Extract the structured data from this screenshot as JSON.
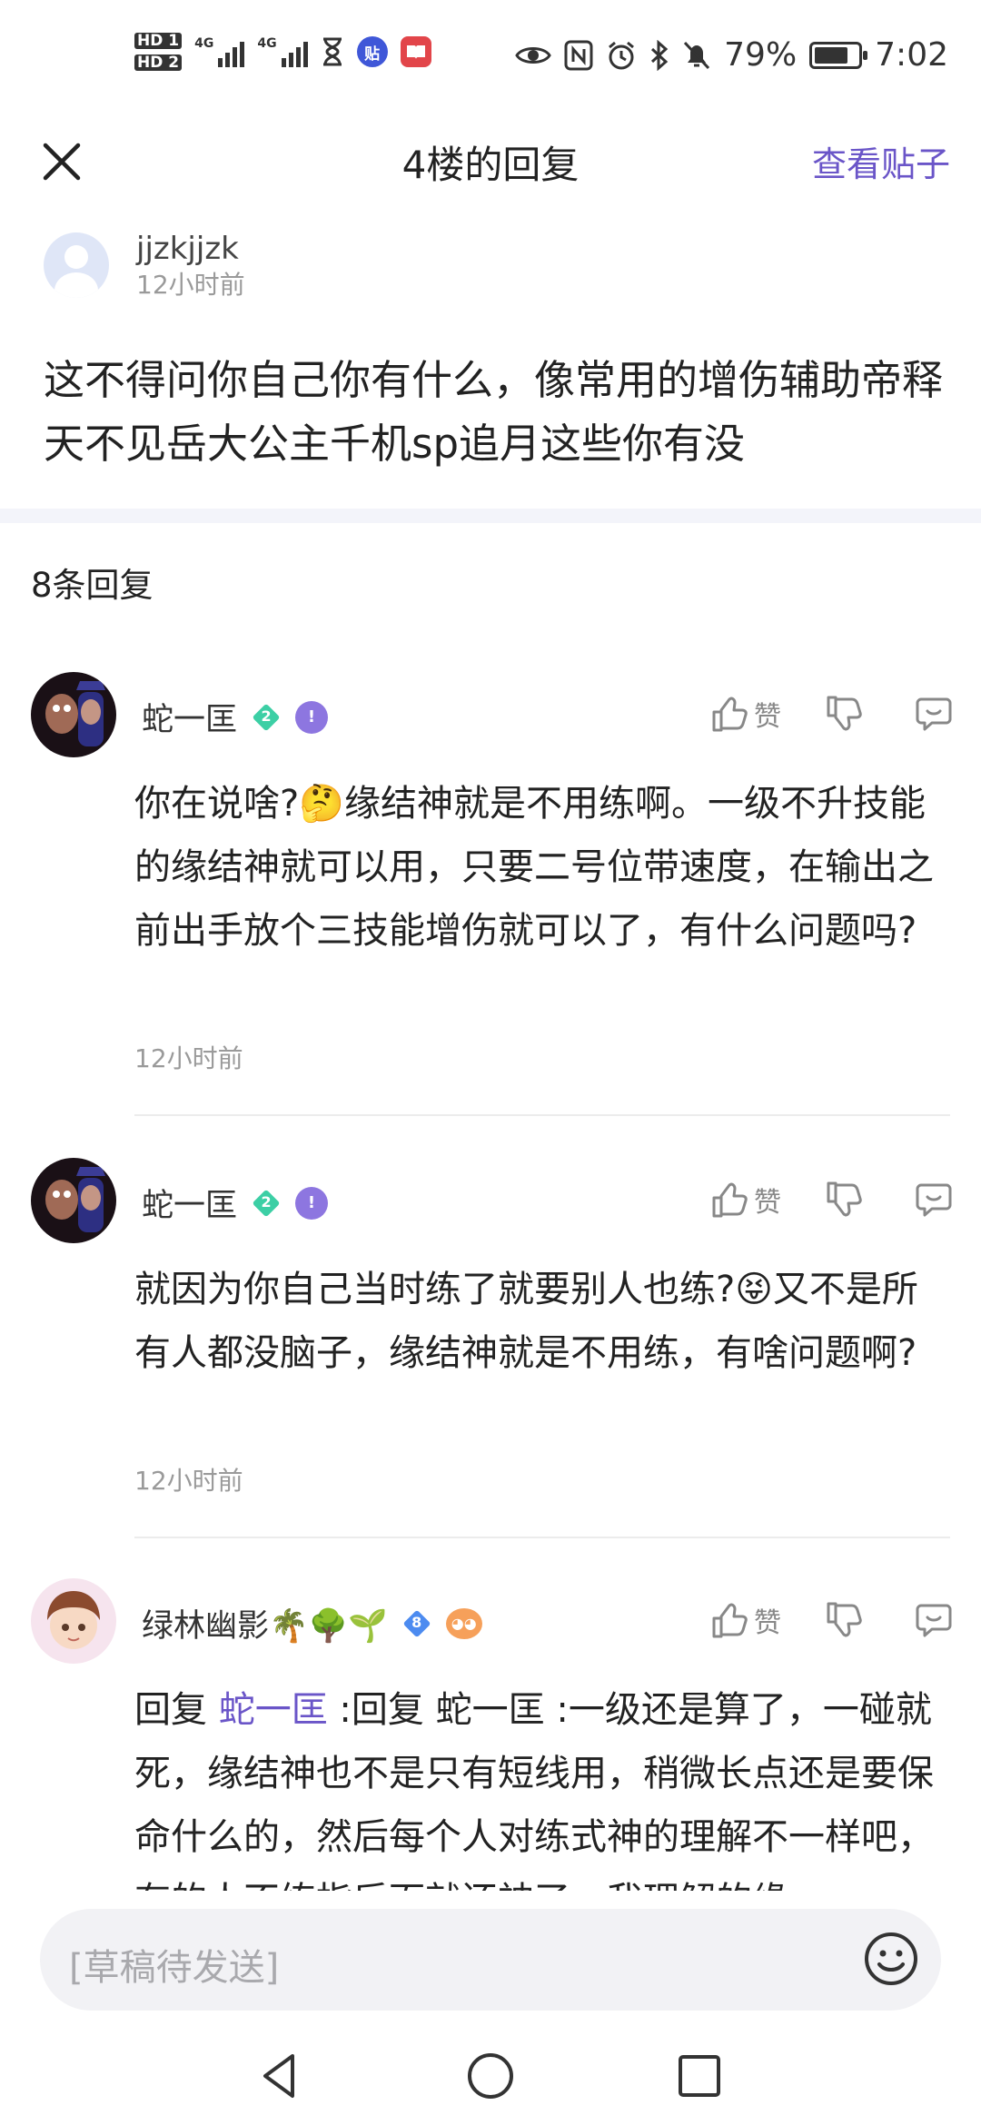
{
  "status_bar": {
    "hd1": "HD 1",
    "hd2": "HD 2",
    "net1": "4G",
    "net2": "4G",
    "app_icon_tieba": "贴",
    "battery_percent": "79%",
    "battery_level": 0.79,
    "time": "7:02"
  },
  "header": {
    "title": "4楼的回复",
    "view_post": "查看贴子"
  },
  "post": {
    "author": "jjzkjjzk",
    "time": "12小时前",
    "content": "这不得问你自己你有什么，像常用的增伤辅助帝释天不见岳大公主千机sp追月这些你有没"
  },
  "reply_count": "8条回复",
  "comments": [
    {
      "name": "蛇一匡",
      "level": "2",
      "like_label": "赞",
      "content": "你在说啥?🤔缘结神就是不用练啊。一级不升技能的缘结神就可以用，只要二号位带速度，在输出之前出手放个三技能增伤就可以了，有什么问题吗?",
      "time": "12小时前"
    },
    {
      "name": "蛇一匡",
      "level": "2",
      "like_label": "赞",
      "content": "就因为你自己当时练了就要别人也练?😝又不是所有人都没脑子，缘结神就是不用练，有啥问题啊?",
      "time": "12小时前"
    },
    {
      "name": "绿林幽影🌴🌳🌱",
      "level": "8",
      "like_label": "赞",
      "reply_prefix": "回复",
      "reply_to": "蛇一匡",
      "content": " :回复 蛇一匡 :一级还是算了，一碰就死，缘结神也不是只有短线用，稍微长点还是要保命什么的，然后每个人对练式神的理解不一样吧，有的人不练指后面就还神了，我理解的缘"
    }
  ],
  "input": {
    "placeholder": "[草稿待发送]"
  },
  "colors": {
    "accent": "#6a55c8",
    "divider_band": "#f3f4fa",
    "input_bg": "#f2f2f5"
  }
}
